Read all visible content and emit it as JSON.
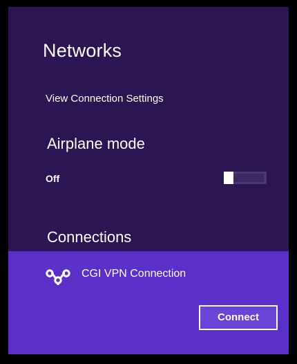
{
  "panel": {
    "title": "Networks",
    "view_settings_label": "View Connection Settings"
  },
  "airplane_mode": {
    "heading": "Airplane mode",
    "state_label": "Off",
    "enabled": false
  },
  "connections": {
    "heading": "Connections",
    "items": [
      {
        "name": "CGI VPN Connection",
        "icon": "vpn-link-icon",
        "action_label": "Connect",
        "selected": true
      }
    ]
  },
  "colors": {
    "panel_background": "#2b1553",
    "selected_row": "#5b30c9",
    "button_fill": "#6b43d6",
    "text": "#ffffff"
  }
}
